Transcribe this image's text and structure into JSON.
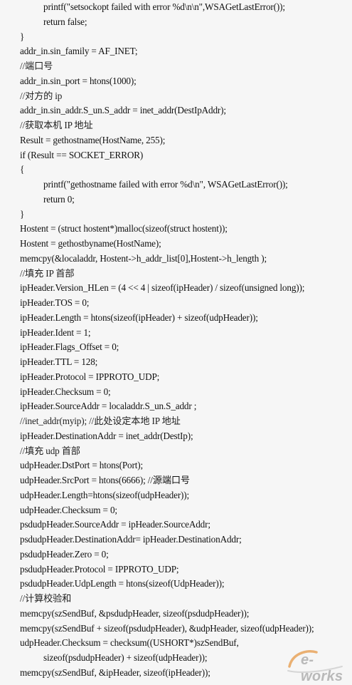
{
  "code_lines": [
    {
      "text": "printf(\"setsockopt failed with error %d\\n\\n\",WSAGetLastError());",
      "indent": 1
    },
    {
      "text": "return false;",
      "indent": 1
    },
    {
      "text": "}",
      "indent": 0
    },
    {
      "text": "addr_in.sin_family = AF_INET;",
      "indent": 0
    },
    {
      "text": "//端口号",
      "indent": 0
    },
    {
      "text": "addr_in.sin_port = htons(1000);",
      "indent": 0
    },
    {
      "text": "//对方的 ip",
      "indent": 0
    },
    {
      "text": "addr_in.sin_addr.S_un.S_addr = inet_addr(DestIpAddr);",
      "indent": 0
    },
    {
      "text": "//获取本机 IP 地址",
      "indent": 0
    },
    {
      "text": "Result = gethostname(HostName, 255);",
      "indent": 0
    },
    {
      "text": "if (Result == SOCKET_ERROR)",
      "indent": 0
    },
    {
      "text": "{",
      "indent": 0
    },
    {
      "text": "printf(\"gethostname failed with error %d\\n\", WSAGetLastError());",
      "indent": 1
    },
    {
      "text": "return 0;",
      "indent": 1
    },
    {
      "text": "}",
      "indent": 0
    },
    {
      "text": "Hostent = (struct hostent*)malloc(sizeof(struct hostent));",
      "indent": 0
    },
    {
      "text": "Hostent = gethostbyname(HostName);",
      "indent": 0
    },
    {
      "text": "memcpy(&localaddr, Hostent->h_addr_list[0],Hostent->h_length );",
      "indent": 0
    },
    {
      "text": "//填充 IP 首部",
      "indent": 0
    },
    {
      "text": "ipHeader.Version_HLen = (4 << 4 | sizeof(ipHeader) / sizeof(unsigned long));",
      "indent": 0
    },
    {
      "text": "ipHeader.TOS = 0;",
      "indent": 0
    },
    {
      "text": "ipHeader.Length = htons(sizeof(ipHeader) + sizeof(udpHeader));",
      "indent": 0
    },
    {
      "text": "ipHeader.Ident = 1;",
      "indent": 0
    },
    {
      "text": "ipHeader.Flags_Offset = 0;",
      "indent": 0
    },
    {
      "text": "ipHeader.TTL = 128;",
      "indent": 0
    },
    {
      "text": "ipHeader.Protocol = IPPROTO_UDP;",
      "indent": 0
    },
    {
      "text": "ipHeader.Checksum = 0;",
      "indent": 0
    },
    {
      "text": "ipHeader.SourceAddr = localaddr.S_un.S_addr ;",
      "indent": 0
    },
    {
      "text": "//inet_addr(myip); //此处设定本地 IP 地址",
      "indent": 0
    },
    {
      "text": "ipHeader.DestinationAddr = inet_addr(DestIp);",
      "indent": 0
    },
    {
      "text": "//填充 udp 首部",
      "indent": 0
    },
    {
      "text": "udpHeader.DstPort = htons(Port);",
      "indent": 0
    },
    {
      "text": "udpHeader.SrcPort = htons(6666); //源端口号",
      "indent": 0
    },
    {
      "text": "udpHeader.Length=htons(sizeof(udpHeader));",
      "indent": 0
    },
    {
      "text": "udpHeader.Checksum = 0;",
      "indent": 0
    },
    {
      "text": "psdudpHeader.SourceAddr = ipHeader.SourceAddr;",
      "indent": 0
    },
    {
      "text": "psdudpHeader.DestinationAddr= ipHeader.DestinationAddr;",
      "indent": 0
    },
    {
      "text": "psdudpHeader.Zero = 0;",
      "indent": 0
    },
    {
      "text": "psdudpHeader.Protocol = IPPROTO_UDP;",
      "indent": 0
    },
    {
      "text": "psdudpHeader.UdpLength = htons(sizeof(UdpHeader));",
      "indent": 0
    },
    {
      "text": "//计算校验和",
      "indent": 0
    },
    {
      "text": "memcpy(szSendBuf, &psdudpHeader, sizeof(psdudpHeader));",
      "indent": 0
    },
    {
      "text": "memcpy(szSendBuf + sizeof(psdudpHeader), &udpHeader, sizeof(udpHeader));",
      "indent": 0
    },
    {
      "text": "udpHeader.Checksum = checksum((USHORT*)szSendBuf,",
      "indent": 0
    },
    {
      "text": "sizeof(psdudpHeader) + sizeof(udpHeader));",
      "indent": 1
    },
    {
      "text": "memcpy(szSendBuf, &ipHeader, sizeof(ipHeader));",
      "indent": 0
    }
  ],
  "watermark": {
    "text": "e-works",
    "color": "#b9b9b9",
    "accent": "#e8a35a"
  }
}
